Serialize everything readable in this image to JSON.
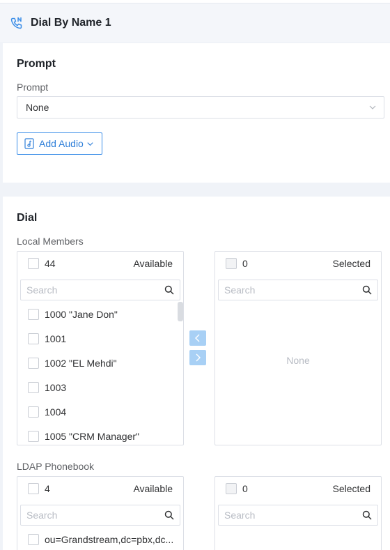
{
  "header": {
    "title": "Dial By Name 1",
    "icon": "phone-forward-icon"
  },
  "prompt_section": {
    "title": "Prompt",
    "field_label": "Prompt",
    "select_value": "None",
    "add_audio_label": "Add Audio"
  },
  "dial_section": {
    "title": "Dial",
    "local_members": {
      "label": "Local Members",
      "available": {
        "count": "44",
        "heading": "Available",
        "search_placeholder": "Search",
        "items": [
          "1000 \"Jane Don\"",
          "1001",
          "1002 \"EL Mehdi\"",
          "1003",
          "1004",
          "1005 \"CRM Manager\""
        ]
      },
      "selected": {
        "count": "0",
        "heading": "Selected",
        "search_placeholder": "Search",
        "empty_text": "None"
      }
    },
    "ldap_phonebook": {
      "label": "LDAP Phonebook",
      "available": {
        "count": "4",
        "heading": "Available",
        "search_placeholder": "Search",
        "items": [
          "ou=Grandstream,dc=pbx,dc..."
        ]
      },
      "selected": {
        "count": "0",
        "heading": "Selected",
        "search_placeholder": "Search"
      }
    }
  },
  "colors": {
    "accent": "#2f7fd9",
    "transfer_button": "#a8d0f5",
    "header_bg": "#f4f6fa"
  }
}
